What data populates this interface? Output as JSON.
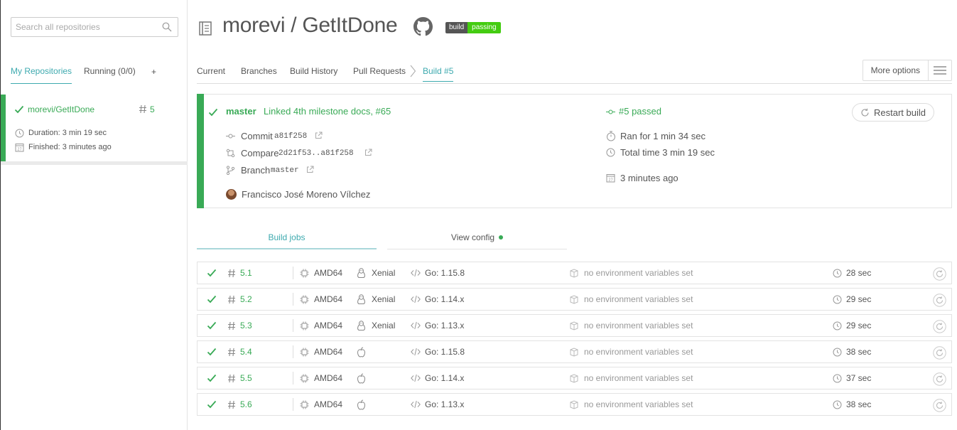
{
  "sidebar": {
    "search_placeholder": "Search all repositories",
    "tabs": [
      {
        "label": "My Repositories",
        "active": true
      },
      {
        "label": "Running (0/0)",
        "active": false
      },
      {
        "label": "+",
        "active": false
      }
    ],
    "repo": {
      "name": "morevi/GetItDone",
      "build_number": "5",
      "duration": "Duration: 3 min 19 sec",
      "finished": "Finished: 3 minutes ago",
      "status_color": "#39aa56"
    }
  },
  "header": {
    "title": "morevi / GetItDone",
    "badge_left": "build",
    "badge_right": "passing"
  },
  "nav": {
    "tabs": [
      {
        "label": "Current"
      },
      {
        "label": "Branches"
      },
      {
        "label": "Build History"
      },
      {
        "label": "Pull Requests"
      },
      {
        "label": "Build #5",
        "active": true
      }
    ],
    "more_options": "More options"
  },
  "build": {
    "branch": "master",
    "message": "Linked 4th milestone docs, #65",
    "commit_label": "Commit",
    "commit_hash": "a81f258",
    "compare_label": "Compare",
    "compare_range": "2d21f53..a81f258",
    "branch_label": "Branch",
    "branch_name": "master",
    "author": "Francisco José Moreno Vílchez",
    "status": "#5 passed",
    "ran_for": "Ran for 1 min 34 sec",
    "total_time": "Total time 3 min 19 sec",
    "finished": "3 minutes ago",
    "restart_label": "Restart build",
    "status_color": "#39aa56"
  },
  "job_tabs": {
    "jobs": "Build jobs",
    "config": "View config"
  },
  "jobs": [
    {
      "number": "5.1",
      "arch": "AMD64",
      "os": "linux",
      "os_label": "Xenial",
      "lang": "Go: 1.15.8",
      "env": "no environment variables set",
      "duration": "28 sec"
    },
    {
      "number": "5.2",
      "arch": "AMD64",
      "os": "linux",
      "os_label": "Xenial",
      "lang": "Go: 1.14.x",
      "env": "no environment variables set",
      "duration": "29 sec"
    },
    {
      "number": "5.3",
      "arch": "AMD64",
      "os": "linux",
      "os_label": "Xenial",
      "lang": "Go: 1.13.x",
      "env": "no environment variables set",
      "duration": "29 sec"
    },
    {
      "number": "5.4",
      "arch": "AMD64",
      "os": "osx",
      "os_label": "",
      "lang": "Go: 1.15.8",
      "env": "no environment variables set",
      "duration": "38 sec"
    },
    {
      "number": "5.5",
      "arch": "AMD64",
      "os": "osx",
      "os_label": "",
      "lang": "Go: 1.14.x",
      "env": "no environment variables set",
      "duration": "37 sec"
    },
    {
      "number": "5.6",
      "arch": "AMD64",
      "os": "osx",
      "os_label": "",
      "lang": "Go: 1.13.x",
      "env": "no environment variables set",
      "duration": "38 sec"
    }
  ]
}
